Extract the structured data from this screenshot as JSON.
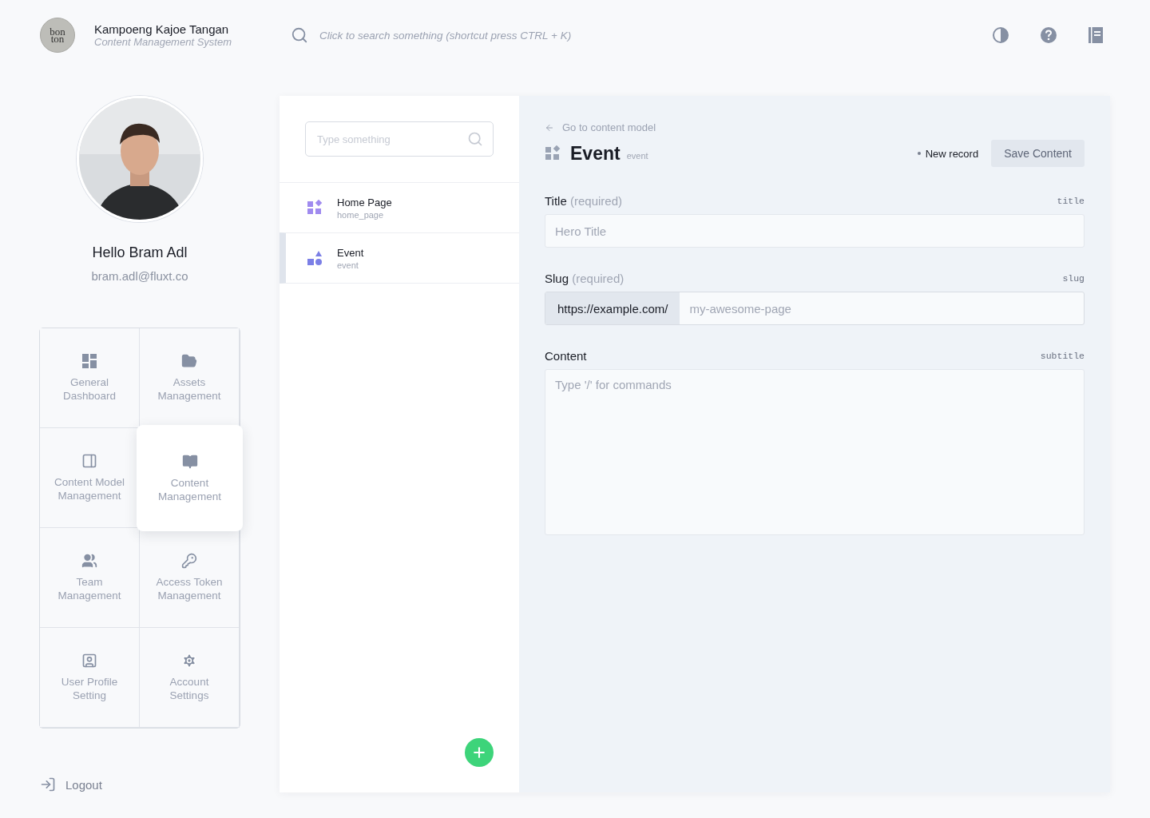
{
  "header": {
    "logo_lines": [
      "bon",
      "ton"
    ],
    "title": "Kampoeng Kajoe Tangan",
    "subtitle": "Content Management System",
    "search_placeholder": "Click to search something (shortcut press CTRL + K)"
  },
  "profile": {
    "greeting": "Hello Bram Adl",
    "email": "bram.adl@fluxt.co"
  },
  "nav": [
    {
      "label": "General Dashboard",
      "selected": false
    },
    {
      "label": "Assets Management",
      "selected": false
    },
    {
      "label": "Content Model Management",
      "selected": false
    },
    {
      "label": "Content Management",
      "selected": true
    },
    {
      "label": "Team Management",
      "selected": false
    },
    {
      "label": "Access Token Management",
      "selected": false
    },
    {
      "label": "User Profile Setting",
      "selected": false
    },
    {
      "label": "Account Settings",
      "selected": false
    }
  ],
  "logout": "Logout",
  "model_list": {
    "search_placeholder": "Type something",
    "items": [
      {
        "name": "Home Page",
        "key": "home_page",
        "selected": false
      },
      {
        "name": "Event",
        "key": "event",
        "selected": true
      }
    ]
  },
  "editor": {
    "back_link": "Go to content model",
    "title": "Event",
    "key": "event",
    "status": "New record",
    "save_button": "Save Content",
    "fields": [
      {
        "kind": "text",
        "label": "Title",
        "hint": "(required)",
        "api_key": "title",
        "placeholder": "Hero Title"
      },
      {
        "kind": "slug",
        "label": "Slug",
        "hint": "(required)",
        "api_key": "slug",
        "prefix": "https://example.com/",
        "placeholder": "my-awesome-page"
      },
      {
        "kind": "richtext",
        "label": "Content",
        "api_key": "subtitle",
        "placeholder": "Type '/' for commands"
      }
    ]
  }
}
